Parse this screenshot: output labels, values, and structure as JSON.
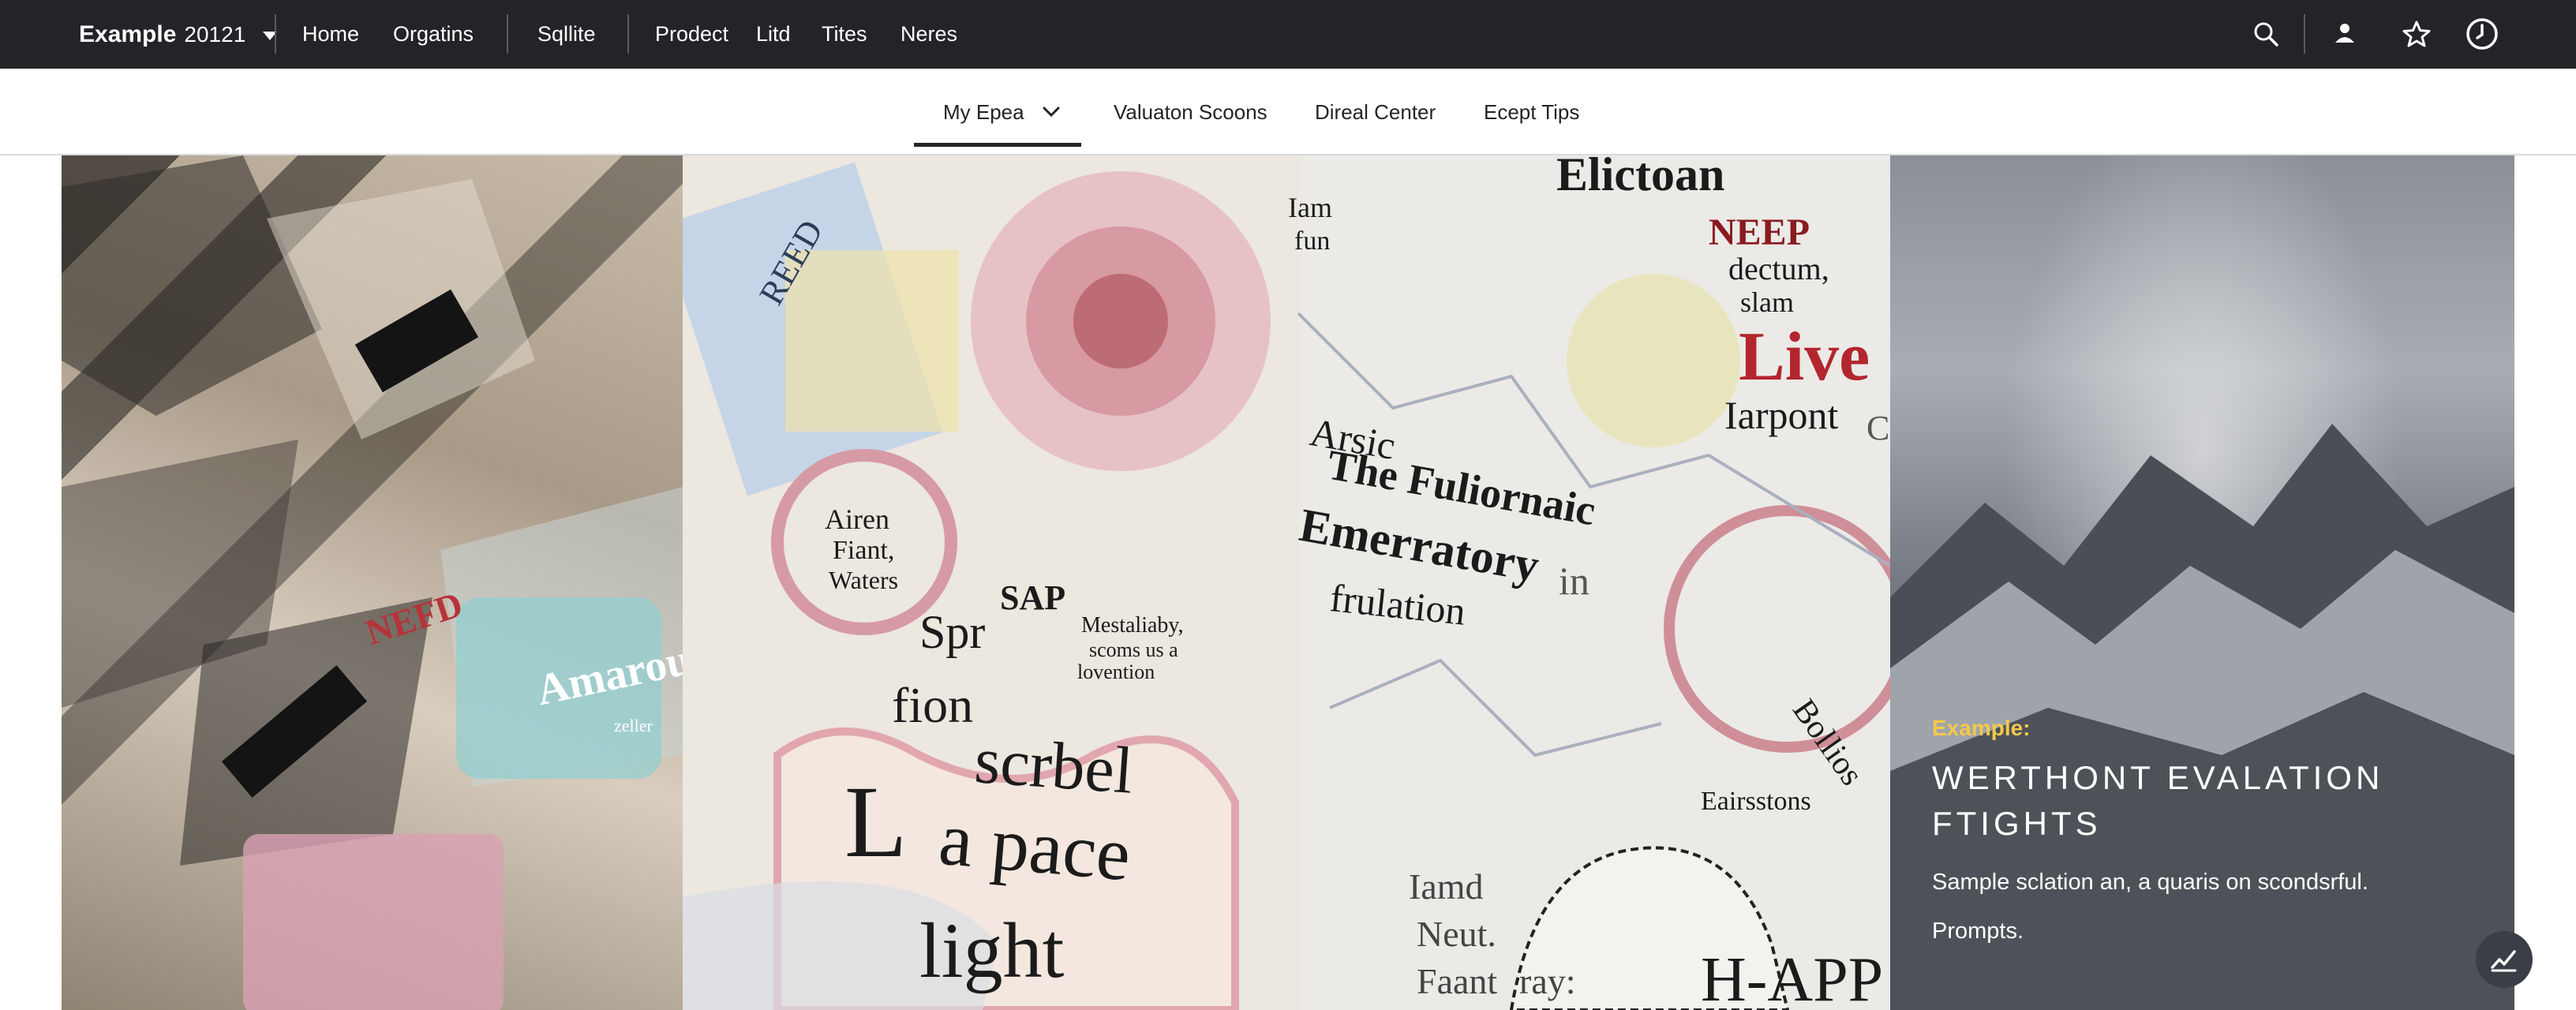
{
  "header": {
    "brand_name": "Example",
    "brand_sub": "20121",
    "nav": [
      "Home",
      "Orgatins",
      "Sqllite",
      "Prodect",
      "Litd",
      "Tites",
      "Neres"
    ],
    "icons": [
      "search-icon",
      "user-icon",
      "star-icon",
      "clock-icon"
    ]
  },
  "subnav": {
    "items": [
      "My Epea",
      "Valuaton Scoons",
      "Direal Center",
      "Ecept Tips"
    ],
    "active": "My Epea"
  },
  "hero": {
    "kicker": "Example:",
    "title": "Werthont Evalation Ftights",
    "description": "Sample sclation an, a quaris on scondsrful.",
    "prompts": "Prompts.",
    "kicker_color": "#f3c94a"
  },
  "collage_text": [
    "Elictoan",
    "NEEP",
    "dectum,",
    "slam",
    "Live",
    "Iarpont",
    "Clan",
    "Arsic",
    "The Fuliornaic",
    "Emerratory",
    "in",
    "frulation",
    "SAP",
    "Mestaliaby,",
    "scoms us a",
    "lovention",
    "Spr",
    "fion",
    "scrbel",
    "L",
    "a pace",
    "light",
    "Airen",
    "Fiant,",
    "Waters",
    "Amaround",
    "zeller",
    "Iam",
    "fun",
    "Eairsstons",
    "Bollios",
    "Iamd",
    "Neut.",
    "Faant",
    "ray:",
    "H-APP",
    "REED",
    "NEFD"
  ]
}
